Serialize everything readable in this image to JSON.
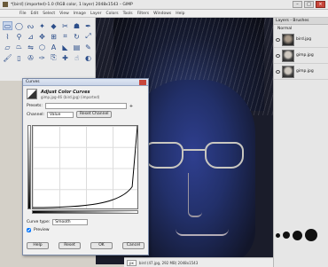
{
  "window": {
    "title": "*[bird] (imported)-1.0 (RGB color, 1 layer) 2048x1543 – GIMP"
  },
  "menu": [
    "File",
    "Edit",
    "Select",
    "View",
    "Image",
    "Layer",
    "Colors",
    "Tools",
    "Filters",
    "Windows",
    "Help"
  ],
  "toolbox": {
    "tools": [
      {
        "name": "rect-select-icon",
        "glyph": "▭"
      },
      {
        "name": "ellipse-select-icon",
        "glyph": "◯"
      },
      {
        "name": "lasso-icon",
        "glyph": "ᔓ"
      },
      {
        "name": "fuzzy-select-icon",
        "glyph": "✦"
      },
      {
        "name": "select-by-color-icon",
        "glyph": "◆"
      },
      {
        "name": "scissors-icon",
        "glyph": "✂"
      },
      {
        "name": "foreground-select-icon",
        "glyph": "☗"
      },
      {
        "name": "paths-icon",
        "glyph": "✒"
      },
      {
        "name": "color-picker-icon",
        "glyph": "⌇"
      },
      {
        "name": "zoom-icon",
        "glyph": "⚲"
      },
      {
        "name": "measure-icon",
        "glyph": "⊿"
      },
      {
        "name": "move-icon",
        "glyph": "✥"
      },
      {
        "name": "align-icon",
        "glyph": "⊞"
      },
      {
        "name": "crop-icon",
        "glyph": "⌗"
      },
      {
        "name": "rotate-icon",
        "glyph": "↻"
      },
      {
        "name": "scale-icon",
        "glyph": "⤢"
      },
      {
        "name": "shear-icon",
        "glyph": "▱"
      },
      {
        "name": "perspective-icon",
        "glyph": "⏢"
      },
      {
        "name": "flip-icon",
        "glyph": "⇋"
      },
      {
        "name": "cage-icon",
        "glyph": "⬡"
      },
      {
        "name": "text-icon",
        "glyph": "A"
      },
      {
        "name": "bucket-fill-icon",
        "glyph": "◣"
      },
      {
        "name": "blend-icon",
        "glyph": "▤"
      },
      {
        "name": "pencil-icon",
        "glyph": "✎"
      },
      {
        "name": "paintbrush-icon",
        "glyph": "🖌"
      },
      {
        "name": "eraser-icon",
        "glyph": "▯"
      },
      {
        "name": "airbrush-icon",
        "glyph": "✇"
      },
      {
        "name": "ink-icon",
        "glyph": "✑"
      },
      {
        "name": "clone-icon",
        "glyph": "⎘"
      },
      {
        "name": "heal-icon",
        "glyph": "✚"
      },
      {
        "name": "smudge-icon",
        "glyph": "☝"
      },
      {
        "name": "dodge-burn-icon",
        "glyph": "◐"
      }
    ]
  },
  "curves": {
    "caption": "Curves",
    "heading": "Adjust Color Curves",
    "subheading": "gimp.jpg-46 (bird.jpg) (imported)",
    "presets_label": "Presets:",
    "channel_label": "Channel:",
    "channel_value": "Value",
    "reset_channel": "Reset Channel",
    "curve_type_label": "Curve type:",
    "curve_type_value": "Smooth",
    "preview_label": "Preview",
    "help": "Help",
    "reset": "Reset",
    "ok": "OK",
    "cancel": "Cancel"
  },
  "status": {
    "unit": "px",
    "message": "bird (47.jpg, 292 MB) 2048x1543"
  },
  "dock": {
    "title": "Layers - Brushes",
    "mode": "Normal",
    "layers": [
      {
        "name": "bird.jpg"
      },
      {
        "name": "gimp.jpg"
      },
      {
        "name": "gimp.jpg"
      }
    ]
  }
}
